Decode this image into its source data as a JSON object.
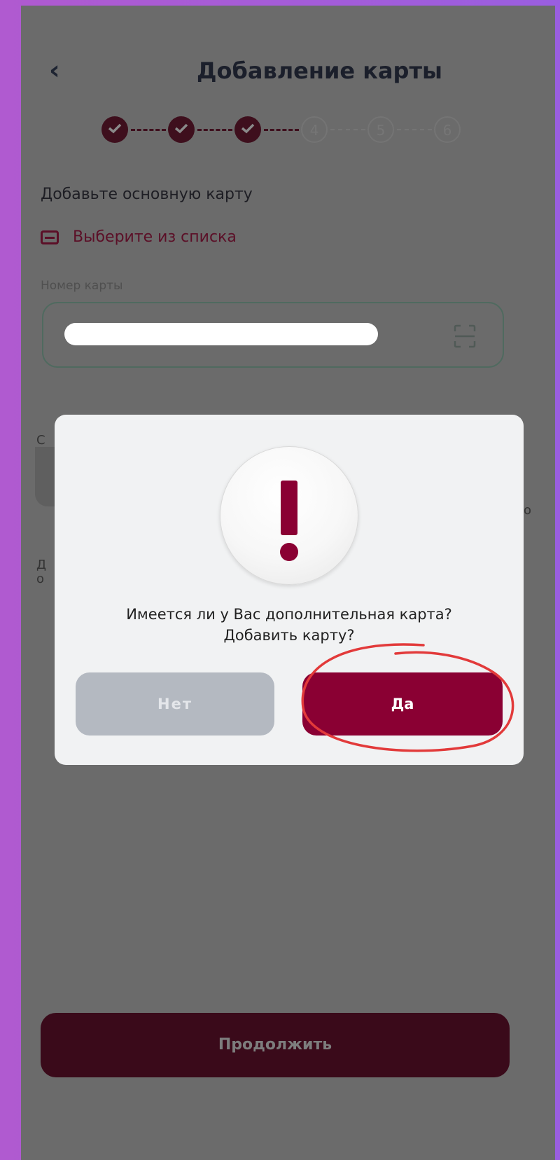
{
  "header": {
    "title": "Добавление карты"
  },
  "stepper": {
    "completed": 3,
    "total": 6,
    "pending_steps": [
      "4",
      "5",
      "6"
    ]
  },
  "form": {
    "section_title": "Добавьте основную карту",
    "choose_from_list": "Выберите из списка",
    "card_number_label": "Номер карты"
  },
  "background_fragments": {
    "left_c": "С",
    "left_d": "Д",
    "left_o": "о",
    "right_o": "о"
  },
  "footer": {
    "continue_label": "Продолжить"
  },
  "dialog": {
    "message_line1": "Имеется ли у Вас дополнительная карта?",
    "message_line2": "Добавить карту?",
    "no_label": "Нет",
    "yes_label": "Да"
  },
  "colors": {
    "brand": "#8a0033",
    "overlay": "#6b6b6b",
    "frame": "#b05ad0",
    "highlight_ring": "#e23a3a"
  },
  "icons": [
    "back-chevron-icon",
    "check-icon",
    "card-icon",
    "scan-card-icon",
    "exclamation-icon"
  ]
}
